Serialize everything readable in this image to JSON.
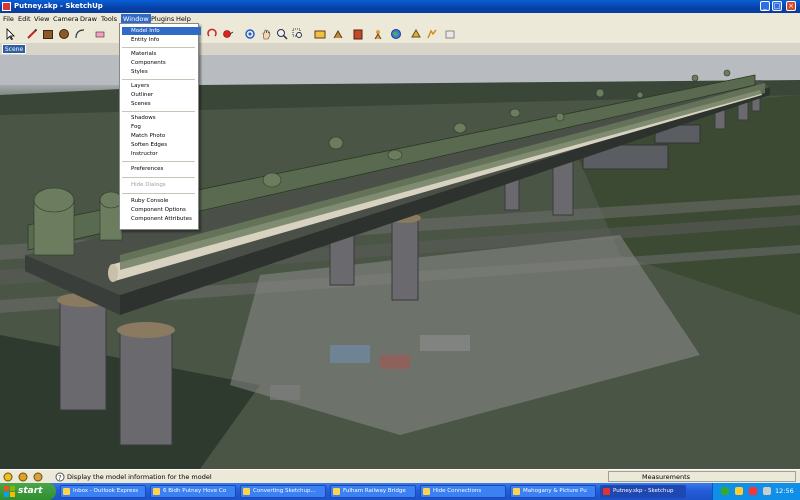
{
  "window": {
    "title": "Putney.skp - SketchUp"
  },
  "menubar": {
    "items": [
      {
        "label": "File"
      },
      {
        "label": "Edit"
      },
      {
        "label": "View"
      },
      {
        "label": "Camera"
      },
      {
        "label": "Draw"
      },
      {
        "label": "Tools"
      },
      {
        "label": "Window"
      },
      {
        "label": "Plugins"
      },
      {
        "label": "Help"
      }
    ]
  },
  "scenes": {
    "active_tab": "Scene 1"
  },
  "window_menu": {
    "items": [
      {
        "label": "Model Info"
      },
      {
        "label": "Entity Info"
      },
      {
        "label": "Materials"
      },
      {
        "label": "Components"
      },
      {
        "label": "Styles"
      },
      {
        "label": "Layers"
      },
      {
        "label": "Outliner"
      },
      {
        "label": "Scenes"
      },
      {
        "label": "Shadows"
      },
      {
        "label": "Fog"
      },
      {
        "label": "Match Photo"
      },
      {
        "label": "Soften Edges"
      },
      {
        "label": "Instructor"
      },
      {
        "label": "Preferences"
      },
      {
        "label": "Hide Dialogs"
      },
      {
        "label": "Ruby Console"
      },
      {
        "label": "Component Options"
      },
      {
        "label": "Component Attributes"
      }
    ],
    "highlight_color": "#e02020"
  },
  "statusbar": {
    "text": "Display the model information for the model",
    "measurements_label": "Measurements"
  },
  "taskbar": {
    "start_label": "start",
    "tasks": [
      {
        "label": "Inbox - Outlook Express"
      },
      {
        "label": "6 Bidh Putney Hove Co"
      },
      {
        "label": "Converting Sketchup..."
      },
      {
        "label": "Fulham Railway Bridge"
      },
      {
        "label": "Hide Connections"
      },
      {
        "label": "Mahogany & Picture Pu"
      },
      {
        "label": "Putney.skp - Sketchup"
      }
    ],
    "clock": "12:56"
  },
  "colors": {
    "titlebar": "#0a4fc8",
    "taskbar": "#245edb",
    "start_button": "#2f8f2f",
    "menu_selection": "#316ac5"
  }
}
